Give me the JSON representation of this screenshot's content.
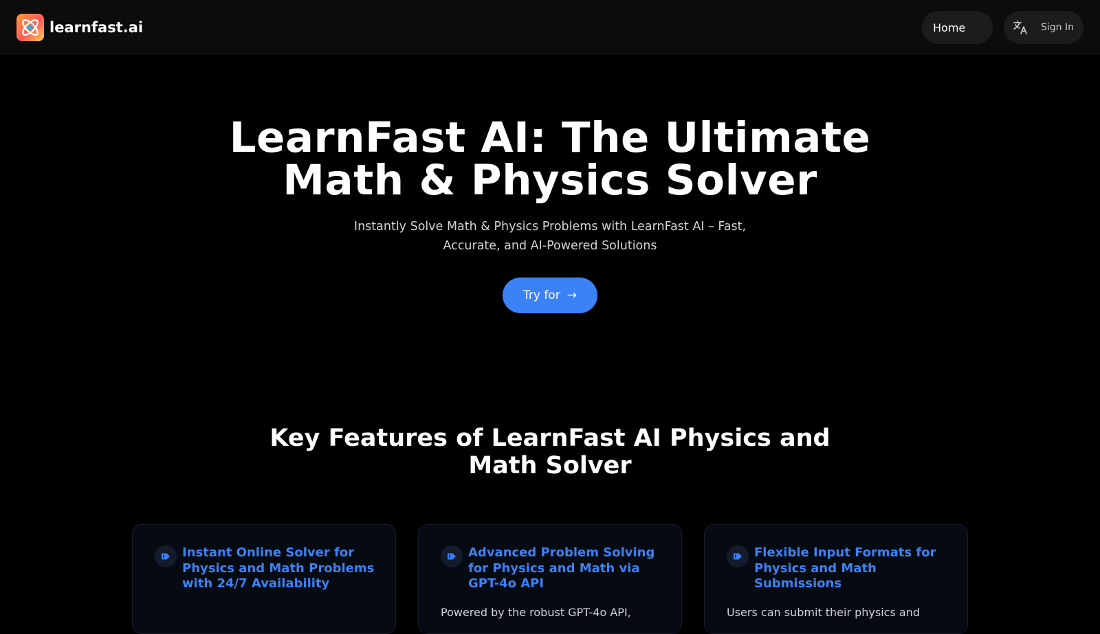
{
  "header": {
    "brand_name": "learnfast.ai",
    "nav_home": "Home",
    "sign_in": "Sign In"
  },
  "hero": {
    "title": "LearnFast AI: The Ultimate Math & Physics Solver",
    "subtitle": "Instantly Solve Math & Physics Problems with LearnFast AI – Fast, Accurate, and AI-Powered Solutions",
    "cta_label": "Try for",
    "cta_arrow": "→"
  },
  "features": {
    "title": "Key Features of LearnFast AI Physics and Math Solver",
    "cards": [
      {
        "title": "Instant Online Solver for Physics and Math Problems with 24/7 Availability",
        "description": ""
      },
      {
        "title": "Advanced Problem Solving for Physics and Math via GPT-4o API",
        "description": "Powered by the robust GPT-4o API,"
      },
      {
        "title": "Flexible Input Formats for Physics and Math Submissions",
        "description": "Users can submit their physics and"
      }
    ]
  },
  "icons": {
    "logo": "atom-logo-icon",
    "translate": "translate-icon",
    "feature": "tag-icon"
  },
  "colors": {
    "accent": "#3b82f6",
    "background": "#000000",
    "header_bg": "#0c0c0d",
    "card_bg": "#060a12"
  }
}
